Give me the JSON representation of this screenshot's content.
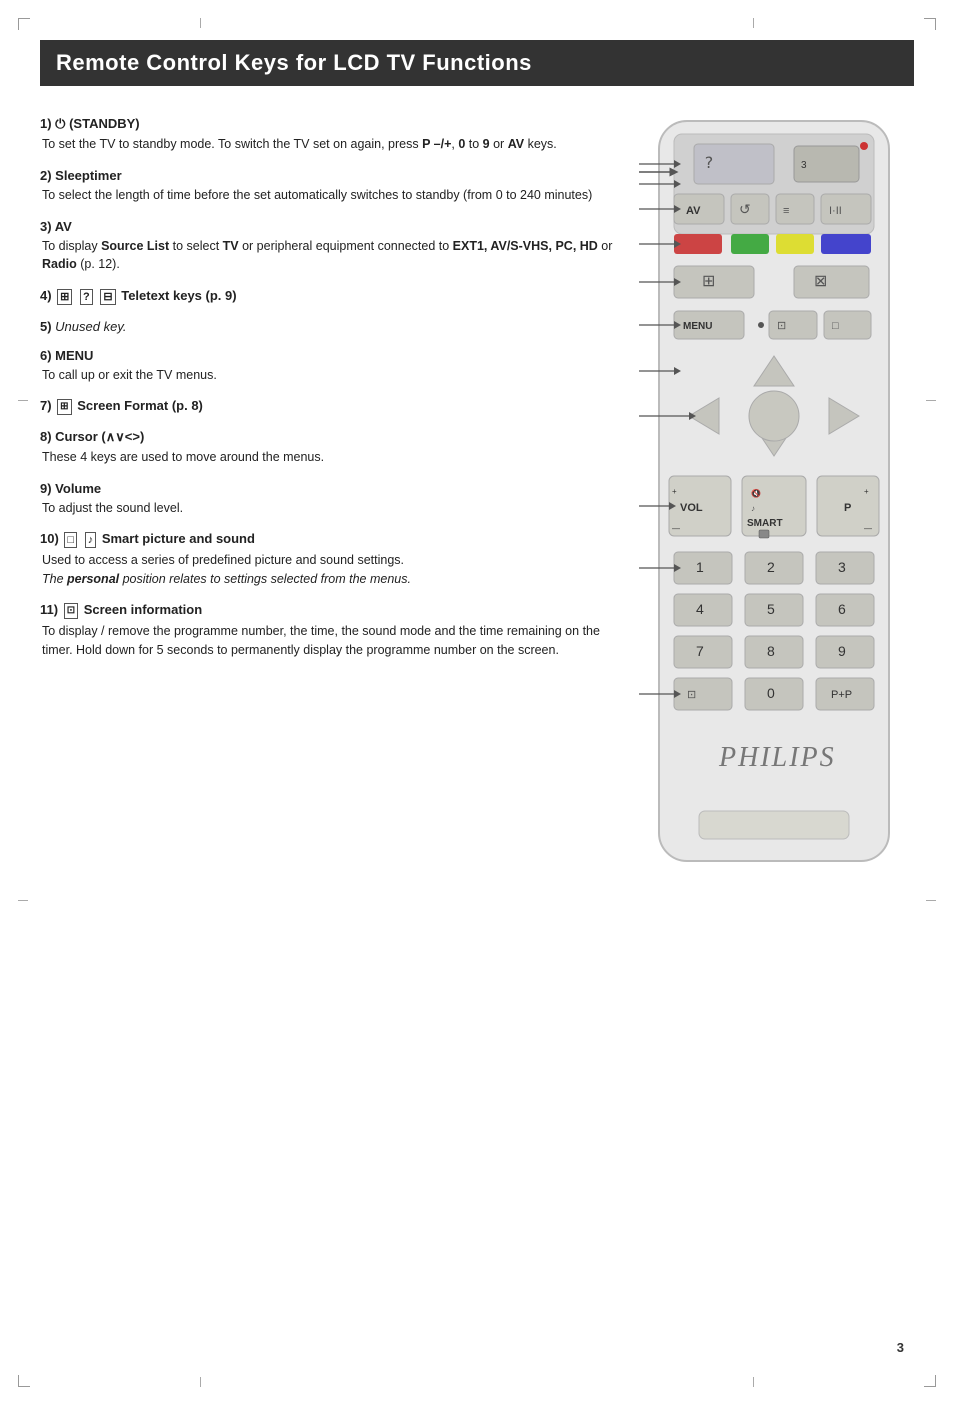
{
  "page": {
    "title": "Remote Control Keys for LCD TV Functions",
    "page_number": "3"
  },
  "items": [
    {
      "num": "1)",
      "icon": "⏻",
      "title": "(STANDBY)",
      "body": "To set the TV to standby mode. To switch the TV set on again, press ",
      "body_parts": [
        {
          "text": "To set the TV to standby mode. To switch the TV set on again, press "
        },
        {
          "text": "P –/+",
          "style": "bold"
        },
        {
          "text": ", "
        },
        {
          "text": "0",
          "style": "bold"
        },
        {
          "text": " to "
        },
        {
          "text": "9",
          "style": "bold"
        },
        {
          "text": " or "
        },
        {
          "text": "AV",
          "style": "bold"
        },
        {
          "text": " keys."
        }
      ]
    },
    {
      "num": "2)",
      "title": "Sleeptimer",
      "body_parts": [
        {
          "text": "To select the length of time before the set automatically switches to standby (from 0 to 240 minutes)"
        }
      ]
    },
    {
      "num": "3)",
      "title": "AV",
      "body_parts": [
        {
          "text": "To display "
        },
        {
          "text": "Source List",
          "style": "bold"
        },
        {
          "text": " to select "
        },
        {
          "text": "TV",
          "style": "bold"
        },
        {
          "text": " or peripheral equipment connected to "
        },
        {
          "text": "EXT1, AV/S-VHS, PC, HD",
          "style": "bold"
        },
        {
          "text": " or "
        },
        {
          "text": "Radio",
          "style": "bold"
        },
        {
          "text": " (p. 12)."
        }
      ]
    },
    {
      "num": "4)",
      "icons": [
        "⊞",
        "?",
        "⊟"
      ],
      "title": "Teletext keys (p. 9)",
      "body_parts": []
    },
    {
      "num": "5)",
      "title": "Unused key.",
      "italic_title": true,
      "body_parts": []
    },
    {
      "num": "6)",
      "title": "MENU",
      "body_parts": [
        {
          "text": "To call up or exit the TV menus."
        }
      ]
    },
    {
      "num": "7)",
      "icon_title": "⊞",
      "title": "Screen Format (p. 8)",
      "body_parts": []
    },
    {
      "num": "8)",
      "title": "Cursor (∧∨<>)",
      "body_parts": [
        {
          "text": "These 4 keys are used to move around the menus."
        }
      ]
    },
    {
      "num": "9)",
      "title": "Volume",
      "body_parts": [
        {
          "text": "To adjust the sound level."
        }
      ]
    },
    {
      "num": "10)",
      "icon_pic": "□",
      "icon_note": "♪",
      "title": "Smart picture and sound",
      "body_parts": [
        {
          "text": "Used to access a series of predefined picture and sound settings."
        },
        {
          "text": "\nThe ",
          "style": "italic"
        },
        {
          "text": "personal",
          "style": "bold-italic"
        },
        {
          "text": " position relates to settings selected from the menus.",
          "style": "italic"
        }
      ]
    },
    {
      "num": "11)",
      "icon_title": "⊡",
      "title": "Screen information",
      "body_parts": [
        {
          "text": "To display / remove the programme number, the time, the sound mode and the time remaining on the timer. Hold down for 5 seconds to permanently display the programme number on the screen."
        }
      ]
    }
  ]
}
